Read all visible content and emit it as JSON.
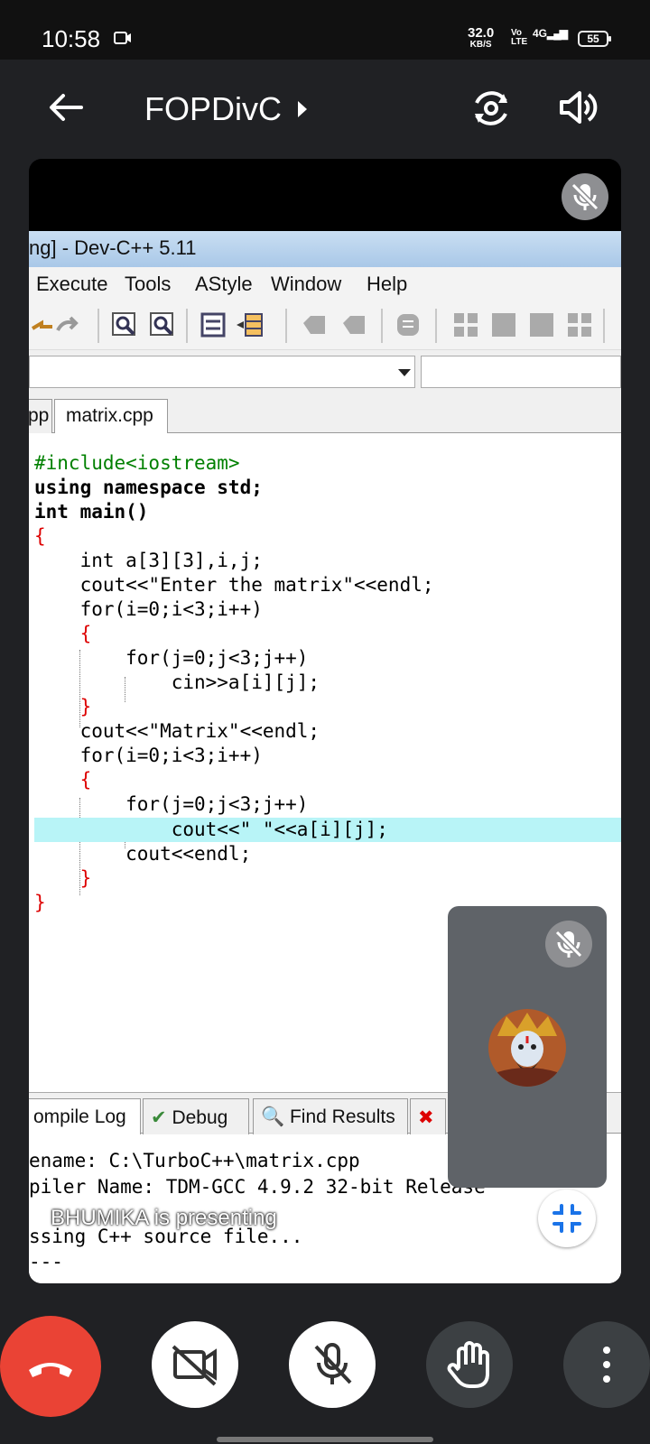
{
  "status_bar": {
    "time": "10:58",
    "net_speed": "32.0",
    "net_speed_unit": "KB/S",
    "network_type": "Vo LTE",
    "signal": "4G",
    "battery": "55"
  },
  "header": {
    "meeting_title": "FOPDivC",
    "icons": [
      "back-arrow-icon",
      "chevron-right-icon",
      "switch-camera-icon",
      "speaker-icon"
    ]
  },
  "shared_screen": {
    "window_title": "ng] - Dev-C++ 5.11",
    "menu": [
      "Execute",
      "Tools",
      "AStyle",
      "Window",
      "Help"
    ],
    "tabs": [
      "pp",
      "matrix.cpp"
    ],
    "code_lines": [
      "#include<iostream>",
      "using namespace std;",
      "int main()",
      "{",
      "    int a[3][3],i,j;",
      "    cout<<\"Enter the matrix\"<<endl;",
      "    for(i=0;i<3;i++)",
      "    {",
      "        for(j=0;j<3;j++)",
      "            cin>>a[i][j];",
      "    }",
      "    cout<<\"Matrix\"<<endl;",
      "    for(i=0;i<3;i++)",
      "    {",
      "        for(j=0;j<3;j++)",
      "            cout<<\" \"<<a[i][j];",
      "        cout<<endl;",
      "    }",
      "}"
    ],
    "bottom_tabs": [
      "ompile Log",
      "Debug",
      "Find Results"
    ],
    "log_lines": [
      "ename: C:\\TurboC++\\matrix.cpp",
      "piler Name: TDM-GCC 4.9.2 32-bit Release",
      "ssing C++ source file...",
      "---"
    ],
    "presenting_label": "BHUMIKA is presenting"
  },
  "colors": {
    "end_call": "#ea4335",
    "background": "#202124",
    "tile": "#5f6368",
    "highlight_line": "#b8f4f7"
  }
}
